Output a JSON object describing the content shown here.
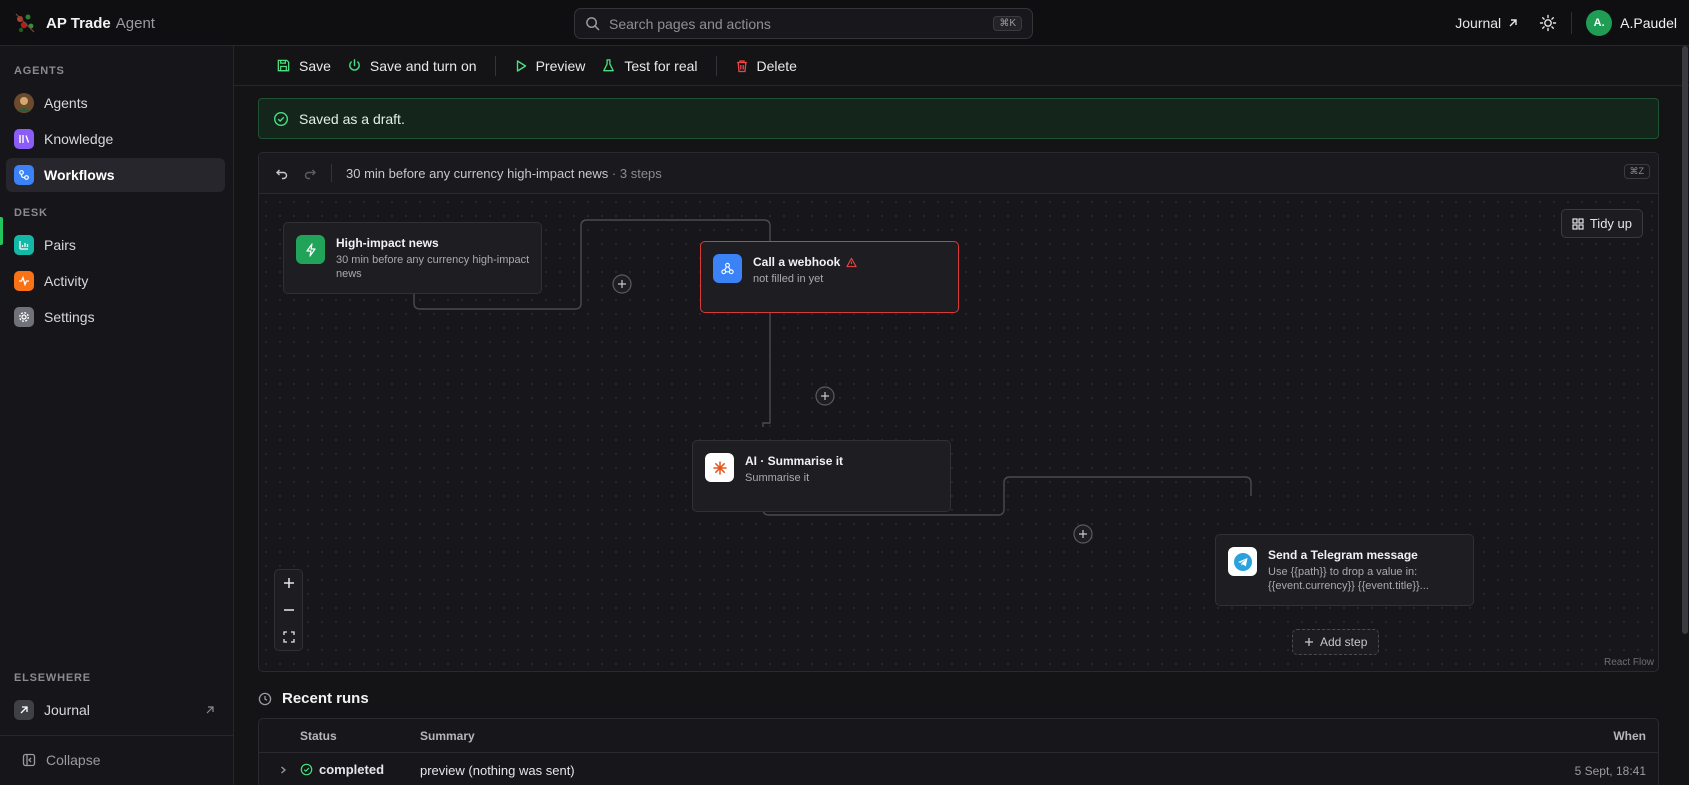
{
  "app": {
    "name": "AP Trade",
    "suffix": "Agent"
  },
  "search": {
    "placeholder": "Search pages and actions",
    "shortcut": "⌘K"
  },
  "topbar": {
    "journal_label": "Journal",
    "user_initials": "A.",
    "user_name": "A.Paudel"
  },
  "sidebar": {
    "sections": [
      {
        "label": "AGENTS",
        "items": [
          {
            "label": "Agents",
            "icon": "agent-avatar-icon"
          },
          {
            "label": "Knowledge",
            "icon": "library-icon"
          },
          {
            "label": "Workflows",
            "icon": "workflow-icon",
            "active": true
          }
        ]
      },
      {
        "label": "DESK",
        "items": [
          {
            "label": "Pairs",
            "icon": "chart-icon"
          },
          {
            "label": "Activity",
            "icon": "pulse-icon"
          },
          {
            "label": "Settings",
            "icon": "gear-icon"
          }
        ]
      },
      {
        "label": "ELSEWHERE",
        "items": [
          {
            "label": "Journal",
            "icon": "external-link-icon"
          }
        ]
      }
    ],
    "collapse_label": "Collapse"
  },
  "toolbar": {
    "save": "Save",
    "save_on": "Save and turn on",
    "preview": "Preview",
    "test": "Test for real",
    "delete": "Delete"
  },
  "banner": {
    "text": "Saved as a draft."
  },
  "canvas": {
    "title": "30 min before any currency high-impact news",
    "meta": "· 3 steps",
    "shortcut": "⌘Z",
    "tidy_label": "Tidy up",
    "add_step_label": "Add step",
    "attribution": "React Flow",
    "nodes": {
      "trigger": {
        "title": "High-impact news",
        "subtitle": "30 min before any currency high-impact news"
      },
      "webhook": {
        "title": "Call a webhook",
        "subtitle": "not filled in yet"
      },
      "ai": {
        "title": "AI · Summarise it",
        "subtitle": "Summarise it"
      },
      "telegram": {
        "title": "Send a Telegram message",
        "subtitle": "Use {{path}} to drop a value in: {{event.currency}} {{event.title}}..."
      }
    }
  },
  "runs": {
    "title": "Recent runs",
    "columns": {
      "status": "Status",
      "summary": "Summary",
      "when": "When"
    },
    "rows": [
      {
        "status": "completed",
        "summary": "preview (nothing was sent)",
        "when": "5 Sept, 18:41"
      }
    ]
  },
  "colors": {
    "accent_green": "#22c55e",
    "error_red": "#d83a3a",
    "delete_red": "#ef4444",
    "banner_bg": "#14261c"
  }
}
